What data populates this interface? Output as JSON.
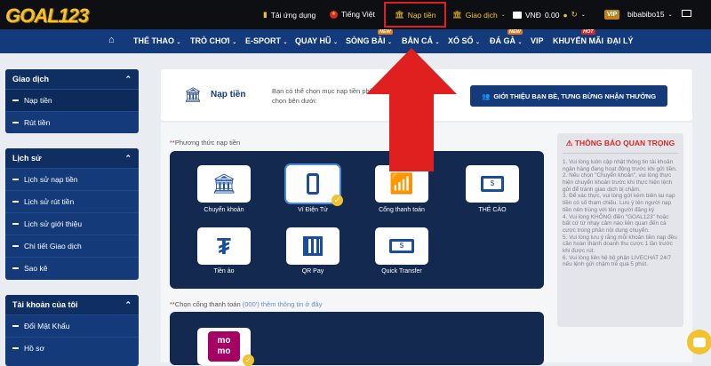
{
  "header": {
    "logo": "GOAL123",
    "download": "Tải ứng dụng",
    "language": "Tiếng Việt",
    "deposit": "Nạp tiền",
    "transactions": "Giao dịch",
    "currency": "VNĐ",
    "balance": "0.00",
    "vip": "VIP",
    "username": "bibabibo15",
    "new_badge": "NEW",
    "hot_badge": "HOT"
  },
  "nav": {
    "items": [
      "THỂ THAO",
      "TRÒ CHƠI",
      "E-SPORT",
      "QUAY HŨ",
      "SÒNG BÀI",
      "BẮN CÁ",
      "XỔ SỐ",
      "ĐÁ GÀ",
      "VIP",
      "KHUYẾN MÃI",
      "ĐẠI LÝ"
    ]
  },
  "sidebar": {
    "groups": [
      {
        "title": "Giao dịch",
        "items": [
          "Nạp tiền",
          "Rút tiền"
        ]
      },
      {
        "title": "Lịch sử",
        "items": [
          "Lịch sử nạp tiền",
          "Lịch sử rút tiền",
          "Lịch sử giới thiệu",
          "Chi tiết Giao dịch",
          "Sao kê"
        ]
      },
      {
        "title": "Tài khoản của tôi",
        "items": [
          "Đổi Mật Khẩu",
          "Hồ sơ"
        ]
      }
    ]
  },
  "main": {
    "title": "Nạp tiền",
    "intro_line1": "Bạn có thể chọn mục nạp tiền phù hợp với nhu cầu",
    "intro_line2": "chọn bên dưới:",
    "referral_button": "GIỚI THIỆU BẠN BÈ, TƯNG BỪNG NHẬN THƯỞNG",
    "methods_label": "*Phương thức nạp tiền",
    "methods": [
      "Chuyển khoản",
      "Ví Điện Tử",
      "Cổng thanh toán",
      "THẺ CÀO",
      "Tiền ảo",
      "QR Pay",
      "Quick Transfer"
    ],
    "gateway_label": "*Chọn cổng thanh toán",
    "gateway_hint": "(000') thêm thông tin ở đây",
    "momo_line1": "mo",
    "momo_line2": "mo"
  },
  "notice": {
    "title": "THÔNG BÁO QUAN TRỌNG",
    "lines": [
      "1. Vui lòng luôn cập nhật thông tin tài khoản ngân hàng đang hoạt động trước khi gửi tiền.",
      "2. Nếu chọn \"Chuyển khoản\", vui lòng thực hiện chuyển khoản trước khi thực hiện lệnh gửi để tránh giao dịch bị chậm.",
      "3. Để xác thực, vui lòng gửi kèm biên lai nạp tiền có số tham chiếu. Lưu ý tên người nạp tiền nên trùng với tên người đăng ký",
      "4. Vui lòng KHÔNG điền \"GOAL123\" hoặc bất cứ từ nhạy cảm nào liên quan đến cá cược trong phần nội dung chuyển.",
      "5. Vui lòng lưu ý rằng mỗi khoản tiền nạp đều cần hoàn thành doanh thu cược 1 lần trước khi được rút.",
      "6. Vui lòng liên hệ bộ phận LIVECHAT 24/7 nếu lệnh gửi chậm trễ quá 5 phút."
    ]
  },
  "colors": {
    "nav_bg": "#133a7a",
    "highlight": "#e0201e",
    "accent": "#f2c230"
  }
}
